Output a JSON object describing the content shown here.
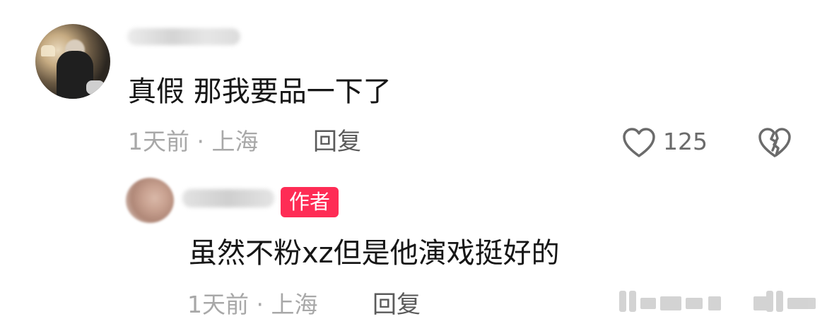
{
  "comment": {
    "text": "真假 那我要品一下了",
    "time_location": "1天前 · 上海",
    "reply_label": "回复",
    "like_count": "125"
  },
  "reply": {
    "badge": "作者",
    "text": "虽然不粉xz但是他演戏挺好的",
    "time_location": "1天前 · 上海",
    "reply_label": "回复"
  },
  "icons": {
    "like": "heart-outline-icon",
    "dislike": "broken-heart-icon"
  },
  "colors": {
    "badge_bg": "#fe2c55",
    "meta_text": "#a8a8a8",
    "body_text": "#161616"
  }
}
